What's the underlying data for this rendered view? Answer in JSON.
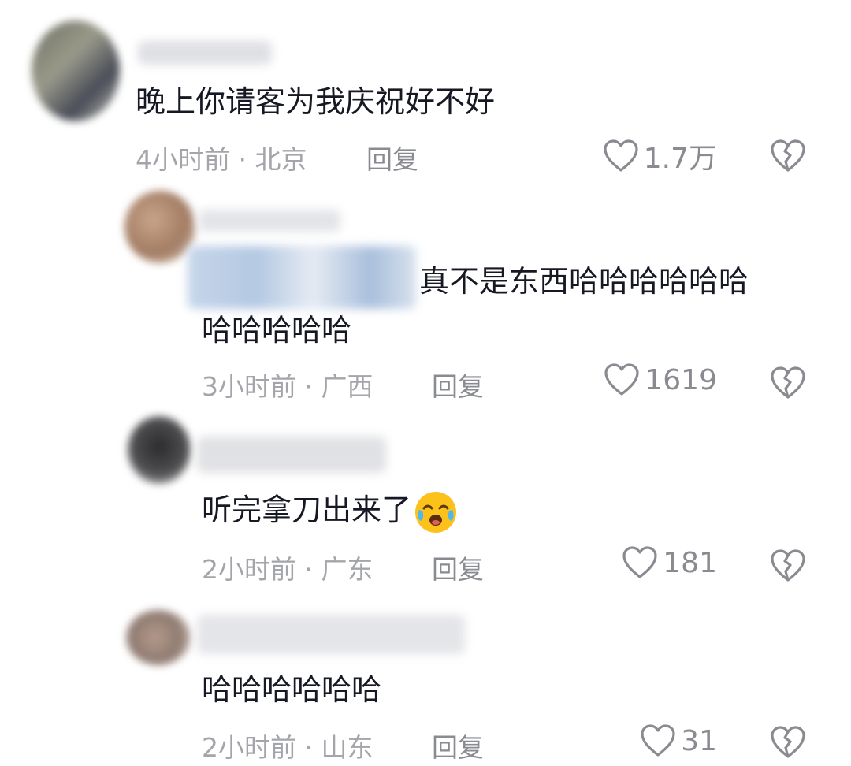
{
  "comments": [
    {
      "text": "晚上你请客为我庆祝好不好",
      "time_location": "4小时前 · 北京",
      "reply_label": "回复",
      "likes": "1.7万"
    },
    {
      "text_line1": "真不是东西哈哈哈哈哈哈",
      "text_line2": "哈哈哈哈哈",
      "time_location": "3小时前 · 广西",
      "reply_label": "回复",
      "likes": "1619"
    },
    {
      "text": "听完拿刀出来了",
      "emoji": "crying-laughing-emoji",
      "time_location": "2小时前 · 广东",
      "reply_label": "回复",
      "likes": "181"
    },
    {
      "text": "哈哈哈哈哈哈",
      "time_location": "2小时前 · 山东",
      "reply_label": "回复",
      "likes": "31"
    }
  ],
  "icons": {
    "like": "heart-outline-icon",
    "dislike": "broken-heart-icon"
  },
  "colors": {
    "text": "#161823",
    "meta": "#a4a5aa",
    "icon": "#8a8b91"
  }
}
